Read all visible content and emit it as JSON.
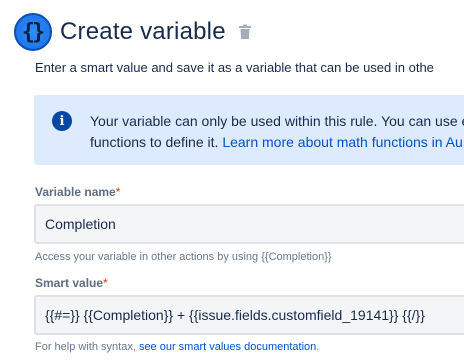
{
  "header": {
    "title": "Create variable",
    "icon": "variable-braces-icon",
    "delete_icon": "trash-icon",
    "accent": "#1a6fe0"
  },
  "description": "Enter a smart value and save it as a variable that can be used in othe",
  "info_banner": {
    "icon": "info-icon",
    "line1": "Your variable can only be used within this rule. You can use e",
    "line2_text": "functions to define it. ",
    "line2_link": "Learn more about math functions in Au",
    "background": "#deebff"
  },
  "variable_name": {
    "label": "Variable name",
    "required_mark": "*",
    "value": "Completion",
    "help": "Access your variable in other actions by using {{Completion}}"
  },
  "smart_value": {
    "label": "Smart value",
    "required_mark": "*",
    "value": "{{#=}} {{Completion}} + {{issue.fields.customfield_19141}} {{/}}",
    "help_text": "For help with syntax, ",
    "help_link": "see our smart values documentation",
    "help_end": "."
  }
}
